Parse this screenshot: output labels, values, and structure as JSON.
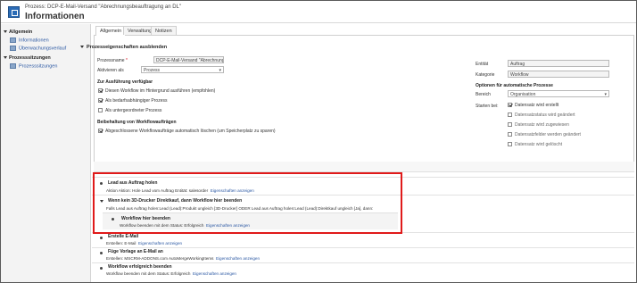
{
  "header": {
    "breadcrumb": "Prozess: DCP-E-Mail-Versand \"Abrechnungsbeauftragung an DL\"",
    "title": "Informationen"
  },
  "sidebar": {
    "sections": [
      {
        "label": "Allgemein",
        "items": [
          "Informationen",
          "Überwachungsverlauf"
        ]
      },
      {
        "label": "Prozesssitzungen",
        "items": [
          "Prozesssitzungen"
        ]
      }
    ]
  },
  "tabs": [
    "Allgemein",
    "Verwaltung",
    "Notizen"
  ],
  "properties": {
    "section_toggle": "Prozesseigenschaften ausblenden",
    "process_name_label": "Prozessname",
    "process_name_value": "DCP-E-Mail-Versand \"Abrechnungsbeau",
    "activate_as_label": "Aktivieren als",
    "activate_as_value": "Prozess",
    "availability_heading": "Zur Ausführung verfügbar",
    "availability_options": [
      {
        "label": "Diesen Workflow im Hintergrund ausführen (empfohlen)",
        "checked": true
      },
      {
        "label": "Als bedarfsabhängiger Prozess",
        "checked": true
      },
      {
        "label": "Als untergeordneter Prozess",
        "checked": false
      }
    ],
    "retention_heading": "Beibehaltung von Workflowaufträgen",
    "retention_option": {
      "label": "Abgeschlossene Workflowaufträge automatisch löschen (um Speicherplatz zu sparen)",
      "checked": true
    },
    "entity_label": "Entität",
    "entity_value": "Auftrag",
    "category_label": "Kategorie",
    "category_value": "Workflow",
    "auto_heading": "Optionen für automatische Prozesse",
    "scope_label": "Bereich",
    "scope_value": "Organisation",
    "start_label": "Starten bei:",
    "start_options": [
      {
        "label": "Datensatz wird erstellt",
        "checked": true
      },
      {
        "label": "Datensatzstatus wird geändert",
        "checked": false
      },
      {
        "label": "Datensatz wird zugewiesen",
        "checked": false
      },
      {
        "label": "Datensatzfelder werden geändert",
        "checked": false
      },
      {
        "label": "Datensatz wird gelöscht",
        "checked": false
      }
    ]
  },
  "steps": {
    "lead_title": "Lead aus Auftrag holen",
    "lead_line": "Aktion  Aktion: Hole Lead vom Auftrag  Entität:  salesorder",
    "lead_link": "Eigenschaften anzeigen",
    "cond_title": "Wenn kein 3D-Drucker Direktkauf, dann Workflow hier beenden",
    "cond_line": "Falls Lead aus Auftrag holen:Lead (Lead):Produkt ungleich [3D-Drucker] ODER Lead aus Auftrag holen:Lead (Lead):Direktkauf ungleich [Ja], dann:",
    "stop_title": "Workflow hier beenden",
    "stop_line": "Workflow beenden mit dem Status:  Erfolgreich",
    "stop_link": "Eigenschaften anzeigen",
    "email_title": "Erstelle E-Mail",
    "email_line": "Erstellen:  E-Mail",
    "email_link": "Eigenschaften anzeigen",
    "template_title": "Füge Vorlage an E-Mail an",
    "template_line": "Erstellen:  MSCRM-ADDONS.com AutoMergeWorkingItems",
    "template_link": "Eigenschaften anzeigen",
    "end_title": "Workflow erfolgreich beenden",
    "end_line": "Workflow beenden mit dem Status:  Erfolgreich",
    "end_link": "Eigenschaften anzeigen"
  },
  "colors": {
    "highlight": "#e01a1a",
    "link": "#2b58a3"
  }
}
